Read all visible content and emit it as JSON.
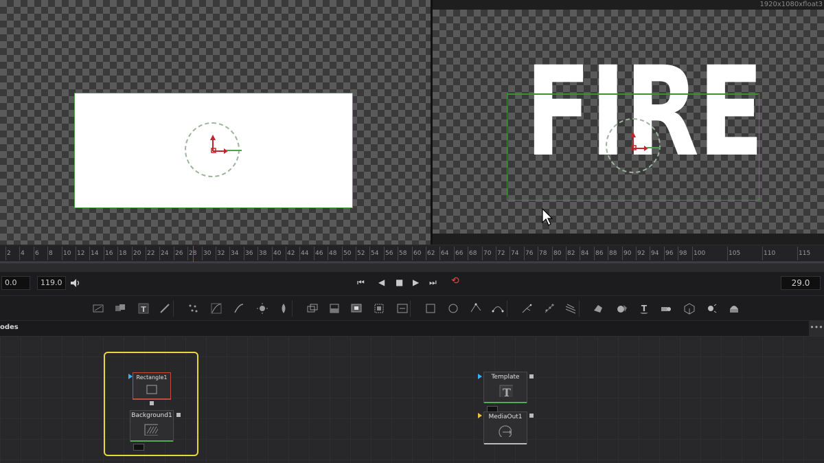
{
  "viewer_right": {
    "resolution_label": "1920x1080xfloat3"
  },
  "fire_text": "FIRE",
  "timeline": {
    "ticks": [
      "2",
      "4",
      "6",
      "8",
      "10",
      "12",
      "14",
      "16",
      "18",
      "20",
      "22",
      "24",
      "26",
      "28",
      "30",
      "32",
      "34",
      "36",
      "38",
      "40",
      "42",
      "44",
      "46",
      "48",
      "50",
      "52",
      "54",
      "56",
      "58",
      "60",
      "62",
      "64",
      "66",
      "68",
      "70",
      "72",
      "74",
      "76",
      "78",
      "80",
      "82",
      "84",
      "86",
      "88",
      "90",
      "92",
      "94",
      "96",
      "98",
      "100",
      "105",
      "110",
      "115"
    ],
    "current_frame": 28
  },
  "transport": {
    "start": "0.0",
    "end": "119.0",
    "fps": "29.0",
    "buttons": {
      "to_start": "⏮",
      "reverse": "◀",
      "stop": "■",
      "play": "▶",
      "to_end": "⏭",
      "loop": "⟲"
    }
  },
  "toolbar": {
    "tools": [
      "background-tool",
      "paint-icon-group",
      "text-tool",
      "paint-tool",
      "particles-tool",
      "color-curves-tool",
      "color-corrector-tool",
      "brightness-tool",
      "blur-tool",
      "merge-tool",
      "channel-booleans-tool",
      "viewer-tool",
      "transform-tool",
      "resize-tool",
      "rectangle-mask-tool",
      "ellipse-mask-tool",
      "polygon-mask-tool",
      "bspline-mask-tool",
      "pemitter-tool",
      "prender-tool",
      "pfriction-tool",
      "shape3d-tool",
      "merge3d-tool",
      "text3d-tool",
      "camera3d-tool",
      "renderer3d-tool",
      "light-tool",
      "image-plane3d-tool"
    ]
  },
  "nodes_panel": {
    "title": "odes",
    "menu_label": "•••",
    "nodes": {
      "rectangle": "Rectangle1",
      "background": "Background1",
      "template": "Template",
      "mediaout": "MediaOut1"
    }
  },
  "colors": {
    "selection": "#e8d83a",
    "node_border_red": "#c84a3a",
    "accent_green": "#4caf50",
    "loop_red": "#e04a3a"
  }
}
